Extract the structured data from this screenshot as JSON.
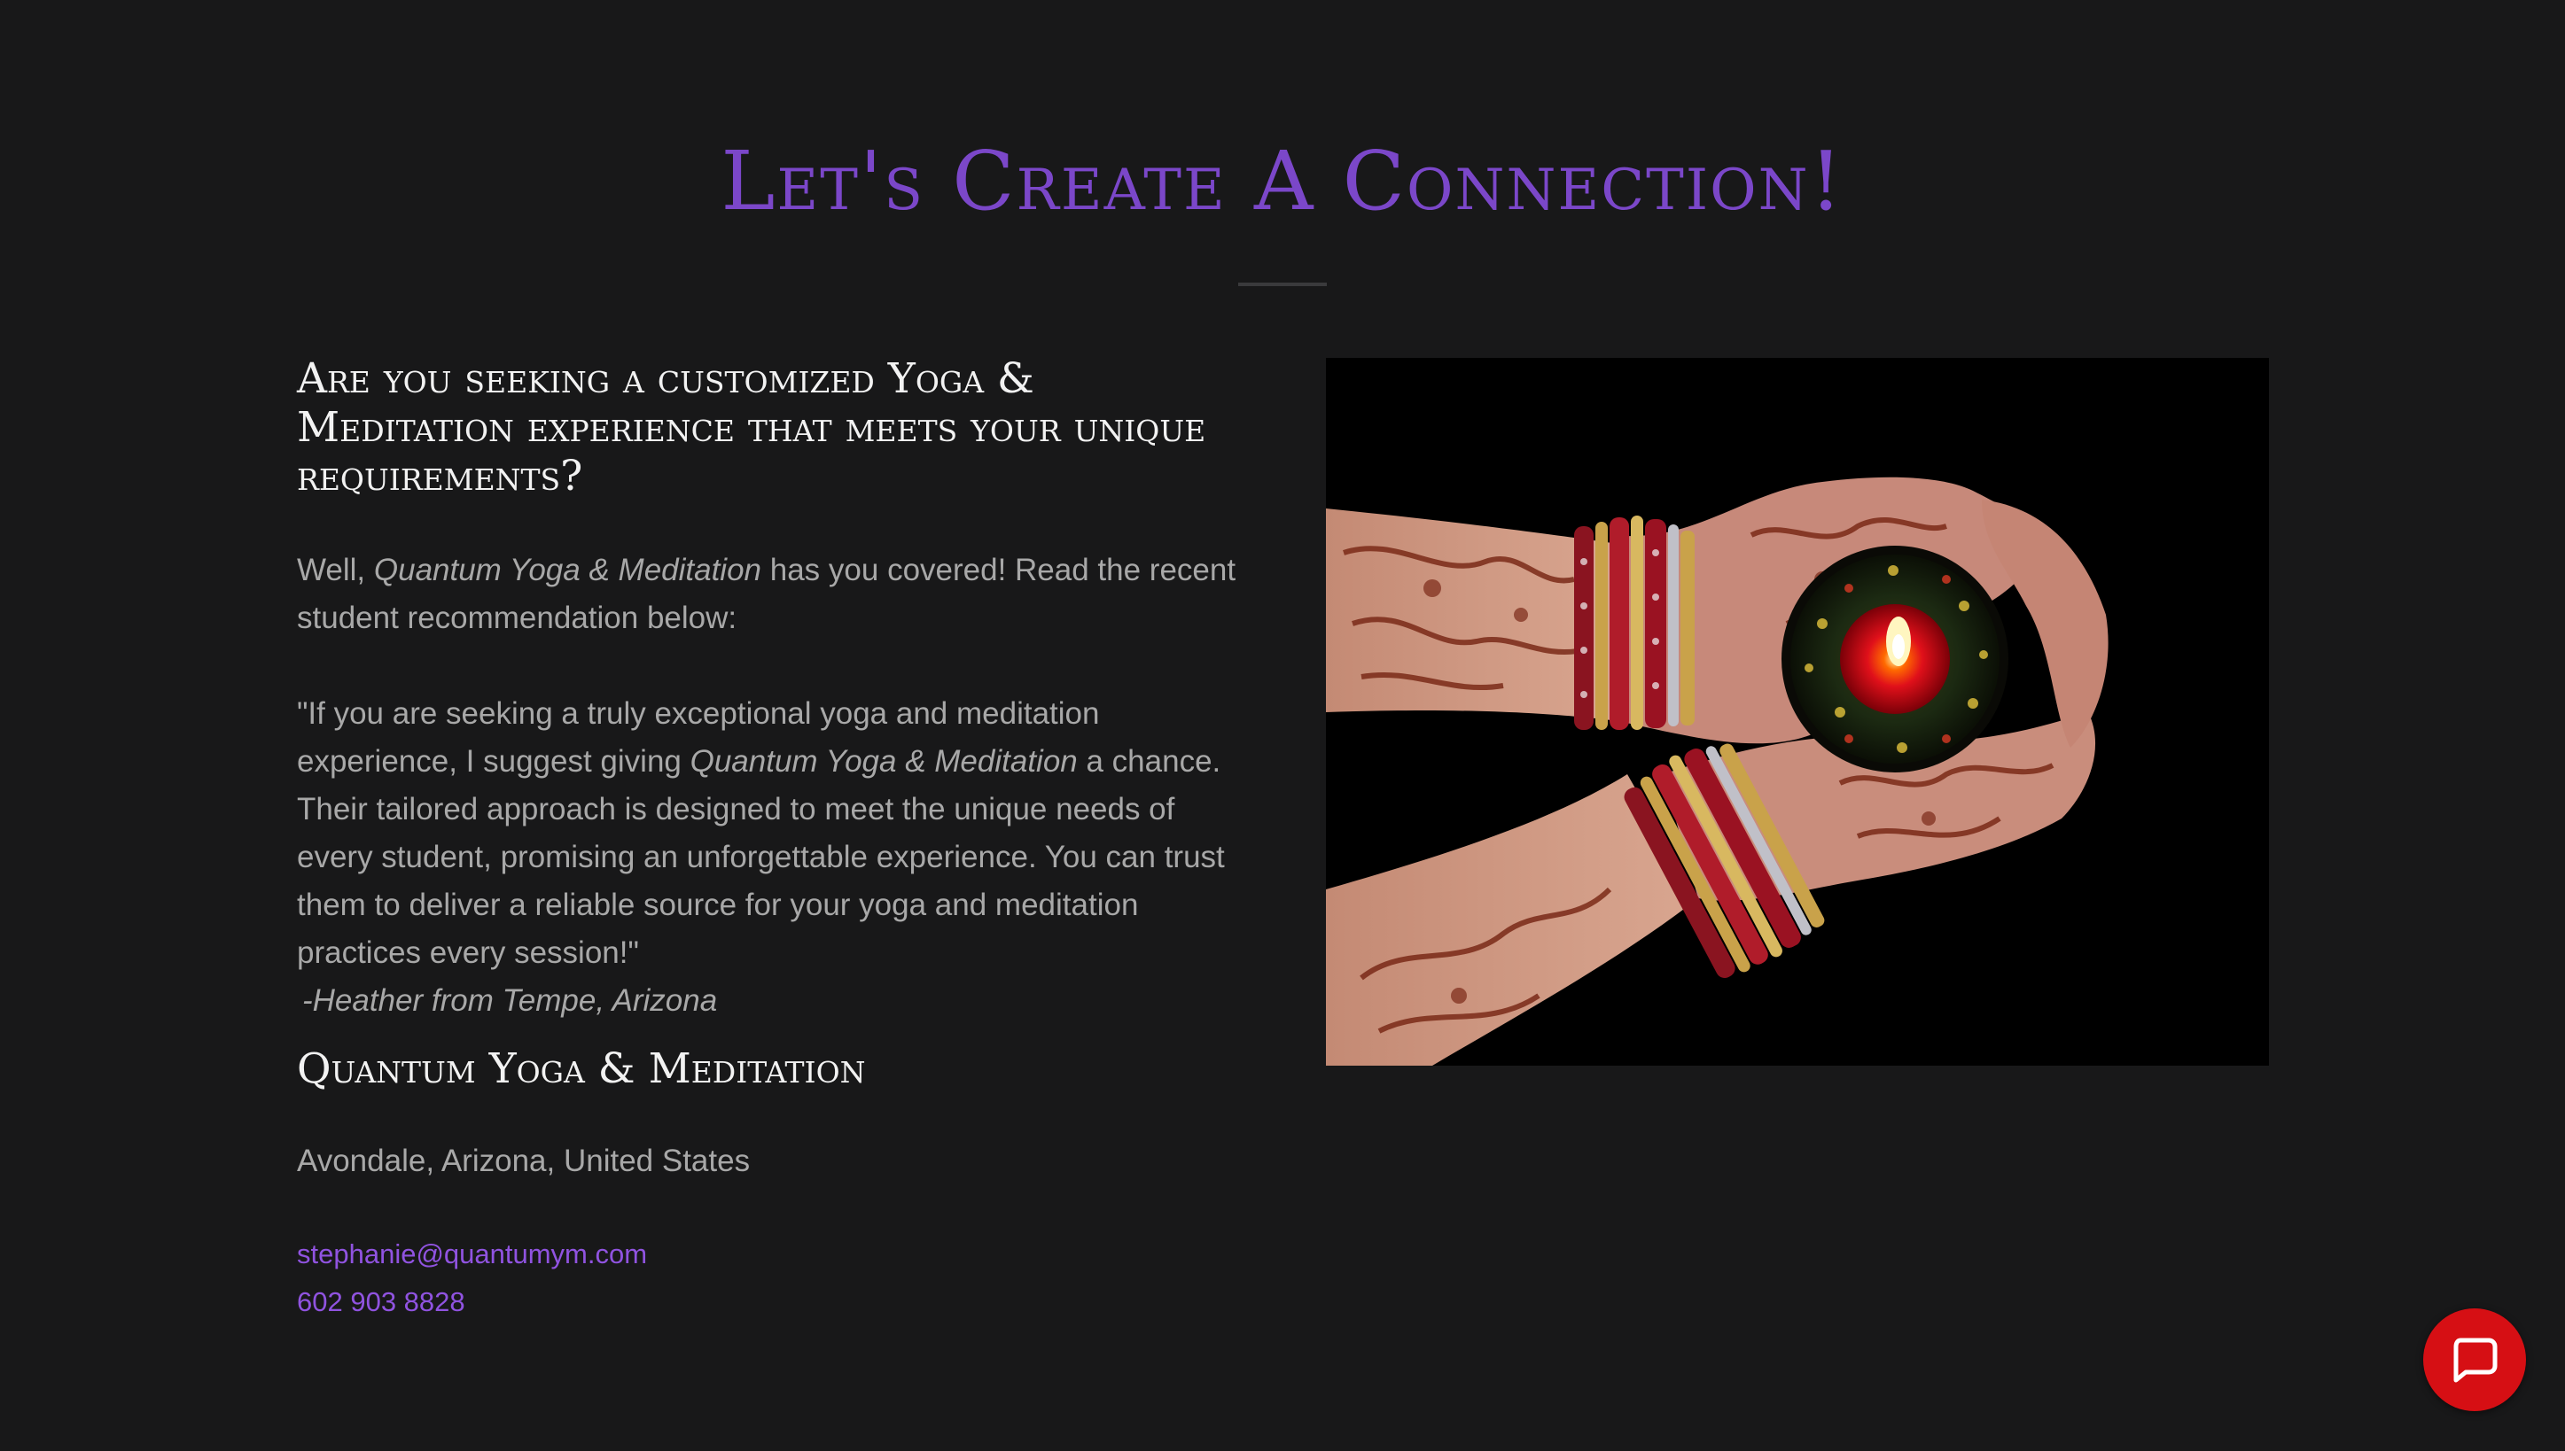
{
  "heading": "Let's Create A Connection!",
  "intro": {
    "question": "Are you seeking a customized Yoga & Meditation experience that meets your unique requirements?",
    "lead_prefix": "Well, ",
    "lead_brand": "Quantum Yoga & Meditation",
    "lead_suffix": " has you covered!  Read the recent student recommendation below:"
  },
  "testimonial": {
    "part1": "\"If you are seeking a truly exceptional yoga and meditation experience, I suggest giving ",
    "brand": "Quantum Yoga & Meditation",
    "part2": " a chance. Their tailored approach is designed to meet the unique needs of every student, promising an unforgettable experience. You can trust them to deliver a reliable source for your yoga and meditation practices every session!\"",
    "author": "-Heather from Tempe, Arizona"
  },
  "business": {
    "name": "Quantum Yoga & Meditation",
    "location": "Avondale, Arizona, United States",
    "email": "stephanie@quantumym.com",
    "phone": "602 903 8828"
  },
  "colors": {
    "background": "#181819",
    "accent": "#7b47c9",
    "link": "#9053e0",
    "chat_button": "#d60f14"
  },
  "icons": {
    "chat": "chat-bubble-icon"
  }
}
